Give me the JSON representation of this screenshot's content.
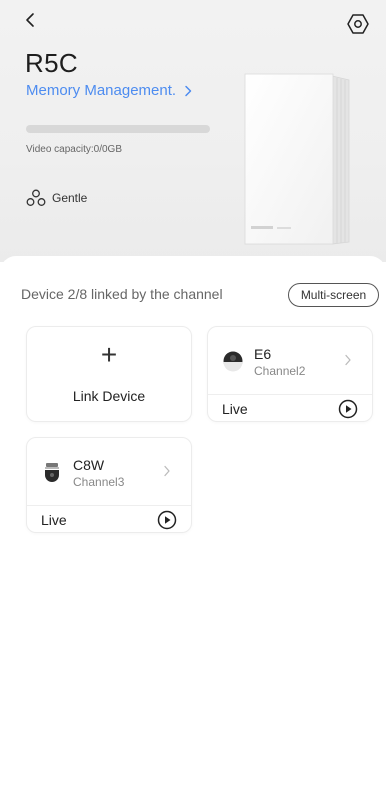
{
  "header": {
    "back_icon": "chevron-left-icon",
    "settings_icon": "settings-hexagon-icon"
  },
  "device": {
    "name": "R5C",
    "memory_link_label": "Memory Management.",
    "memory_link_icon": "chevron-right-icon",
    "capacity_text": "Video capacity:0/0GB",
    "capacity_used_fraction": 0,
    "mode_icon": "fan-icon",
    "mode_label": "Gentle"
  },
  "channels": {
    "summary": "Device 2/8 linked by the channel",
    "multi_screen_label": "Multi-screen"
  },
  "link_card": {
    "icon": "plus-icon",
    "label": "Link Device"
  },
  "cameras": [
    {
      "name": "E6",
      "channel": "Channel2",
      "live_label": "Live",
      "thumb_icon": "dome-camera-icon",
      "play_icon": "play-circle-icon"
    },
    {
      "name": "C8W",
      "channel": "Channel3",
      "live_label": "Live",
      "thumb_icon": "outdoor-camera-icon",
      "play_icon": "play-circle-icon"
    }
  ],
  "colors": {
    "accent": "#4d8cf0",
    "hero_bg": "#efefef"
  }
}
